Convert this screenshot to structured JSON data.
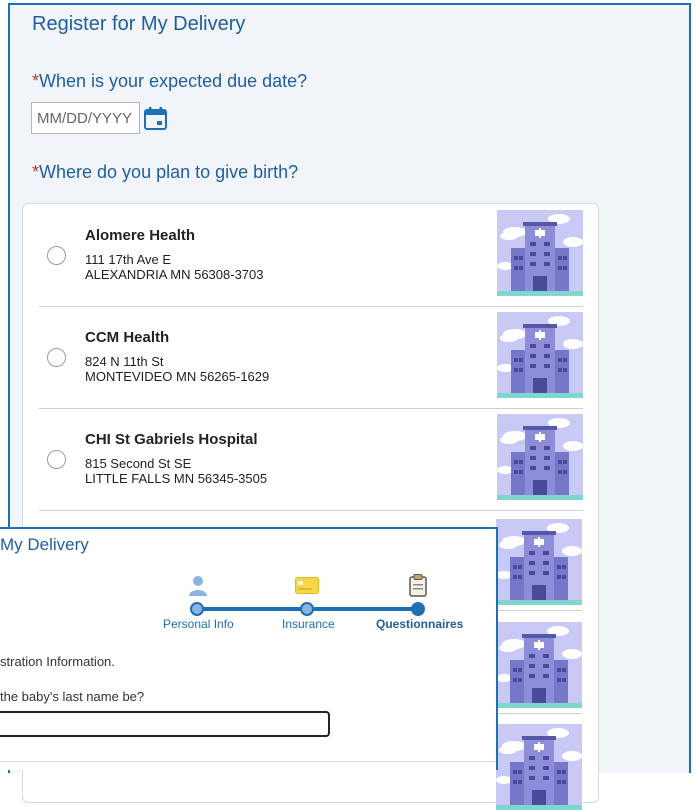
{
  "back_dialog": {
    "title": "Register for My Delivery",
    "due_date": {
      "required_mark": "*",
      "label": "When is your expected due date?",
      "placeholder": "MM/DD/YYYY",
      "icon": "calendar-icon"
    },
    "birth_place": {
      "required_mark": "*",
      "label": "Where do you plan to give birth?"
    },
    "hospitals": [
      {
        "name": "Alomere Health",
        "address1": "111 17th Ave E",
        "address2": "ALEXANDRIA MN 56308-3703"
      },
      {
        "name": "CCM Health",
        "address1": "824 N 11th St",
        "address2": "MONTEVIDEO MN 56265-1629"
      },
      {
        "name": "CHI St Gabriels Hospital",
        "address1": "815 Second St SE",
        "address2": "LITTLE FALLS MN 56345-3505"
      }
    ]
  },
  "front_dialog": {
    "title": "My Delivery",
    "steps": [
      {
        "label": "Personal Info",
        "icon": "person-icon",
        "state": "done"
      },
      {
        "label": "Insurance",
        "icon": "insurance-card-icon",
        "state": "done"
      },
      {
        "label": "Questionnaires",
        "icon": "clipboard-icon",
        "state": "current"
      }
    ],
    "section_text": "stration Information.",
    "question": "the baby's last name be?"
  },
  "colors": {
    "accent": "#1f6fb5",
    "title": "#1f5f9f",
    "required": "#c0392b",
    "background": "#f1f4f9"
  }
}
